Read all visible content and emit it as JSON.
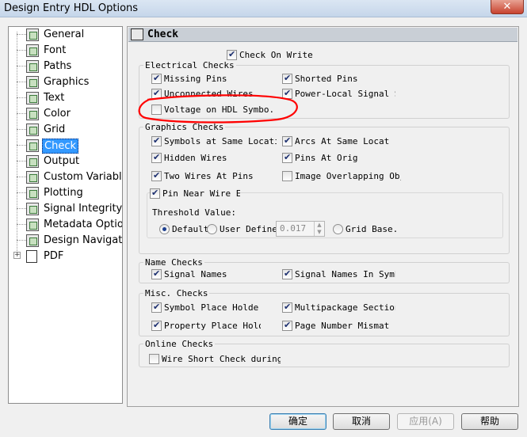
{
  "window": {
    "title": "Design Entry HDL Options",
    "close_glyph": "✕"
  },
  "tree": {
    "items": [
      {
        "label": "General"
      },
      {
        "label": "Font"
      },
      {
        "label": "Paths"
      },
      {
        "label": "Graphics"
      },
      {
        "label": "Text"
      },
      {
        "label": "Color"
      },
      {
        "label": "Grid"
      },
      {
        "label": "Check",
        "selected": true
      },
      {
        "label": "Output"
      },
      {
        "label": "Custom Variables"
      },
      {
        "label": "Plotting"
      },
      {
        "label": "Signal Integrity"
      },
      {
        "label": "Metadata Option"
      },
      {
        "label": "Design Navigatic"
      },
      {
        "label": "PDF",
        "expandable": true
      }
    ],
    "expander_glyph": "+"
  },
  "panel": {
    "header": "Check",
    "check_on_write": {
      "label": "Check On Write",
      "checked": true
    },
    "electrical": {
      "title": "Electrical Checks",
      "items": [
        {
          "label": "Missing Pins",
          "checked": true
        },
        {
          "label": "Shorted Pins",
          "checked": true
        },
        {
          "label": "Unconnected Wires",
          "checked": true
        },
        {
          "label": "Power-Local Signal Sh",
          "checked": true
        },
        {
          "label": "Voltage on HDL Symbo.",
          "checked": false
        }
      ]
    },
    "graphics": {
      "title": "Graphics Checks",
      "items": [
        {
          "label": "Symbols at  Same Locati",
          "checked": true
        },
        {
          "label": "Arcs At Same Locatic",
          "checked": true
        },
        {
          "label": "Hidden Wires",
          "checked": true
        },
        {
          "label": "Pins At Origi",
          "checked": true
        },
        {
          "label": "Two Wires At Pins",
          "checked": true
        },
        {
          "label": "Image Overlapping Obje",
          "checked": false
        }
      ],
      "pin_near_wire": {
        "label": "Pin Near Wire En",
        "checked": true
      },
      "threshold_label": "Threshold Value:",
      "radios": [
        {
          "label": "Default",
          "selected": true
        },
        {
          "label": "User Define",
          "selected": false
        },
        {
          "label": "Grid Base.",
          "selected": false
        }
      ],
      "threshold_value": "0.017",
      "spin_up": "▲",
      "spin_down": "▼"
    },
    "name": {
      "title": "Name Checks",
      "items": [
        {
          "label": "Signal Names",
          "checked": true
        },
        {
          "label": "Signal Names In Symbo",
          "checked": true
        }
      ]
    },
    "misc": {
      "title": "Misc. Checks",
      "items": [
        {
          "label": "Symbol Place Holders",
          "checked": true
        },
        {
          "label": "Multipackage Section:",
          "checked": true
        },
        {
          "label": "Property Place Holde:",
          "checked": true
        },
        {
          "label": "Page Number Mismatch",
          "checked": true
        }
      ]
    },
    "online": {
      "title": "Online Checks",
      "items": [
        {
          "label": "Wire Short Check during m",
          "checked": false
        }
      ]
    }
  },
  "buttons": {
    "ok": "确定",
    "cancel": "取消",
    "apply": "应用(A)",
    "help": "帮助"
  },
  "colors": {
    "selection": "#3399ff",
    "annotation": "#ff0000"
  }
}
